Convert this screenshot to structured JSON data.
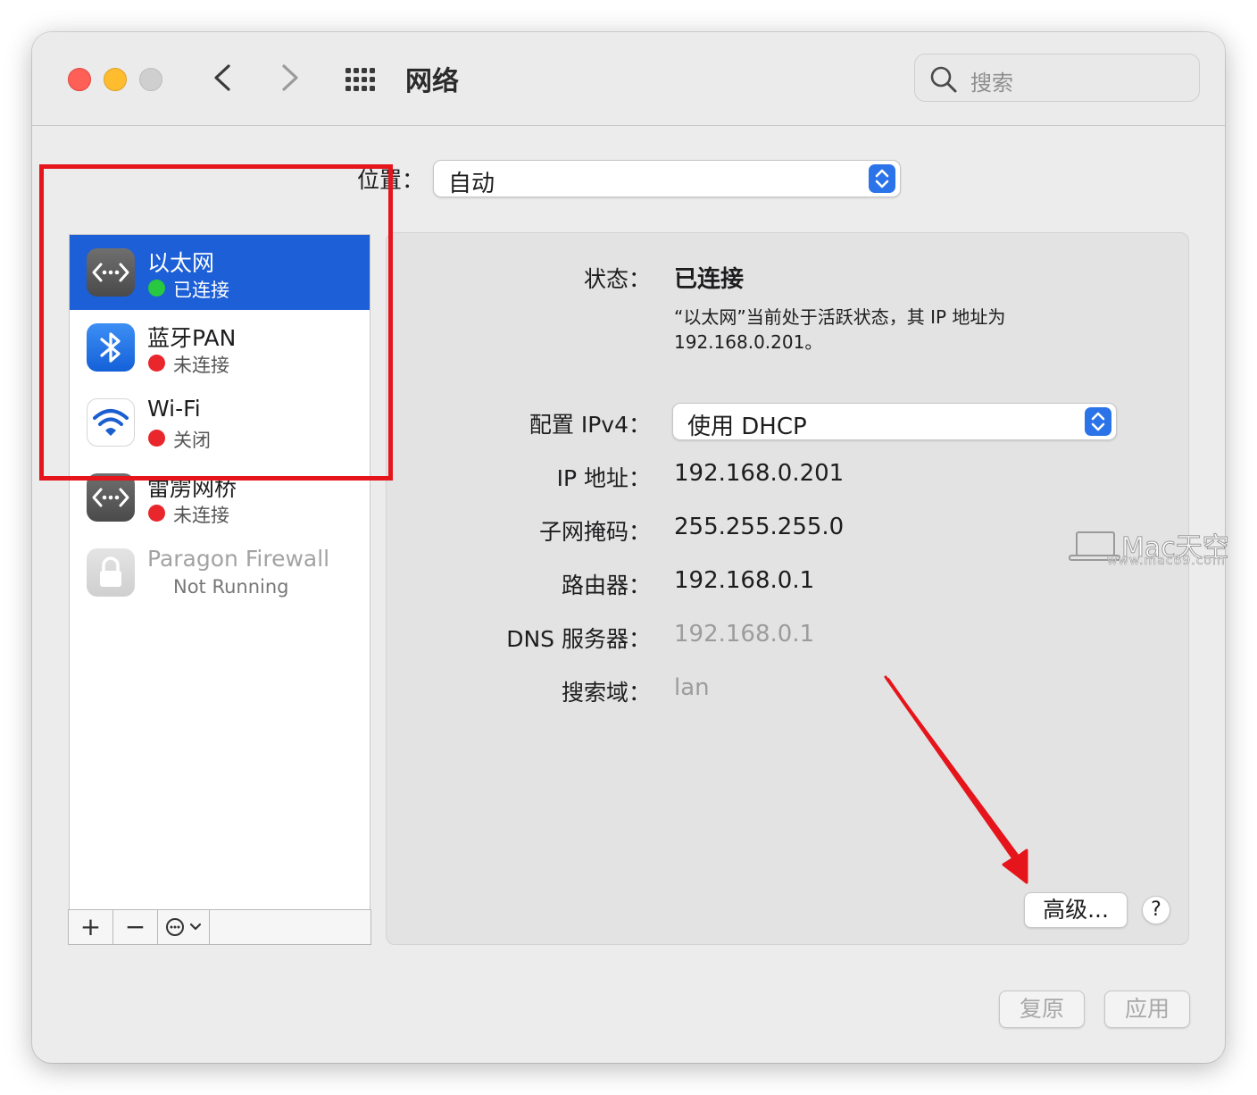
{
  "window": {
    "title": "网络"
  },
  "search": {
    "placeholder": "搜索"
  },
  "location": {
    "label": "位置：",
    "value": "自动"
  },
  "services": [
    {
      "name": "以太网",
      "status": "已连接",
      "status_color": "#28c840",
      "icon": "ethernet-icon",
      "selected": true
    },
    {
      "name": "蓝牙PAN",
      "status": "未连接",
      "status_color": "#e8262b",
      "icon": "bluetooth-icon",
      "selected": false
    },
    {
      "name": "Wi-Fi",
      "status": "关闭",
      "status_color": "#e8262b",
      "icon": "wifi-icon",
      "selected": false
    },
    {
      "name": "雷雳网桥",
      "status": "未连接",
      "status_color": "#e8262b",
      "icon": "ethernet-icon",
      "selected": false
    },
    {
      "name": "Paragon Firewall",
      "status": "Not Running",
      "status_color": "",
      "icon": "lock-icon",
      "selected": false
    }
  ],
  "toolbar": {
    "add": "+",
    "remove": "−",
    "action": "⊙"
  },
  "details": {
    "status_label": "状态：",
    "status_value": "已连接",
    "status_desc": "“以太网”当前处于活跃状态，其 IP 地址为 192.168.0.201。",
    "ipv4_label": "配置 IPv4：",
    "ipv4_value": "使用 DHCP",
    "ip_label": "IP 地址：",
    "ip_value": "192.168.0.201",
    "subnet_label": "子网掩码：",
    "subnet_value": "255.255.255.0",
    "router_label": "路由器：",
    "router_value": "192.168.0.1",
    "dns_label": "DNS 服务器：",
    "dns_value": "192.168.0.1",
    "search_domain_label": "搜索域：",
    "search_domain_value": "lan"
  },
  "buttons": {
    "advanced": "高级...",
    "help": "?",
    "revert": "复原",
    "apply": "应用"
  },
  "watermark": {
    "text": "Mac天空",
    "url": "www.mac69.com"
  },
  "colors": {
    "accent": "#1c5fd6",
    "annotation": "#e5151b"
  }
}
